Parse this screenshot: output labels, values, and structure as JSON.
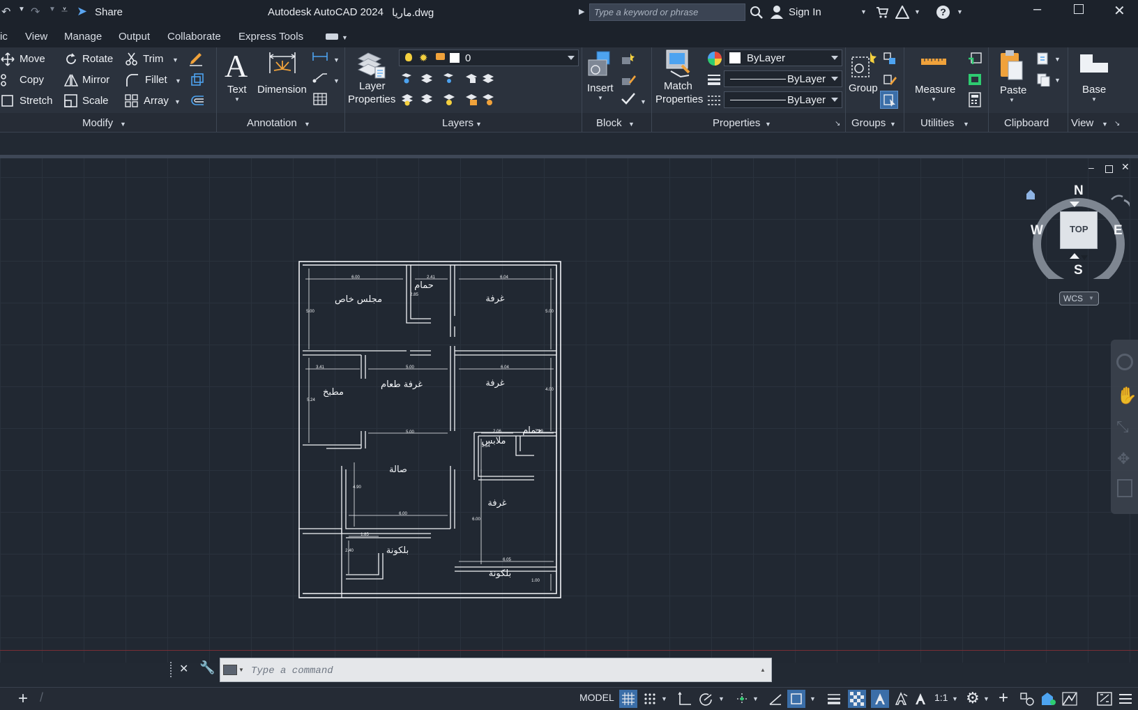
{
  "title_bar": {
    "share_label": "Share",
    "app_title": "Autodesk AutoCAD 2024",
    "file_name": "ماريا.dwg",
    "search_placeholder": "Type a keyword or phrase",
    "sign_in_label": "Sign In"
  },
  "menu_tabs": [
    "ic",
    "View",
    "Manage",
    "Output",
    "Collaborate",
    "Express Tools"
  ],
  "ribbon": {
    "modify": {
      "items": [
        "Move",
        "Rotate",
        "Trim",
        "Copy",
        "Mirror",
        "Fillet",
        "Stretch",
        "Scale",
        "Array"
      ],
      "panel_label": "Modify"
    },
    "annotation": {
      "text_label": "Text",
      "dimension_label": "Dimension",
      "panel_label": "Annotation"
    },
    "layers": {
      "layer_properties_line1": "Layer",
      "layer_properties_line2": "Properties",
      "current_layer": "0",
      "panel_label": "Layers"
    },
    "block": {
      "insert_label": "Insert",
      "panel_label": "Block"
    },
    "properties": {
      "match_line1": "Match",
      "match_line2": "Properties",
      "color_value": "ByLayer",
      "linetype_value": "ByLayer",
      "lineweight_value": "ByLayer",
      "panel_label": "Properties"
    },
    "groups": {
      "group_label": "Group",
      "panel_label": "Groups"
    },
    "utilities": {
      "measure_label": "Measure",
      "panel_label": "Utilities"
    },
    "clipboard": {
      "paste_label": "Paste",
      "panel_label": "Clipboard"
    },
    "view": {
      "base_label": "Base",
      "panel_label": "View"
    }
  },
  "viewcube": {
    "north": "N",
    "south": "S",
    "east": "E",
    "west": "W",
    "face": "TOP",
    "ucs": "WCS"
  },
  "drawing": {
    "rooms": [
      "مجلس خاص",
      "حمام",
      "غرفة",
      "مطبخ",
      "غرفة طعام",
      "غرفة",
      "حمام",
      "ملابس",
      "صالة",
      "غرفة",
      "بلكونة",
      "بلكونة"
    ],
    "dimensions": [
      "6.00",
      "2.41",
      "6.04",
      "2.85",
      "5.00",
      "5.00",
      "3.41",
      "5.00",
      "6.04",
      "5.24",
      "4.00",
      "5.00",
      "2.06",
      "2.19",
      "2.54",
      "4.90",
      "6.00",
      "6.00",
      "1.85",
      "2.40",
      "6.05",
      "1.00"
    ]
  },
  "command_line": {
    "placeholder": "Type a command"
  },
  "status_bar": {
    "model_label": "MODEL",
    "scale_label": "1:1"
  }
}
